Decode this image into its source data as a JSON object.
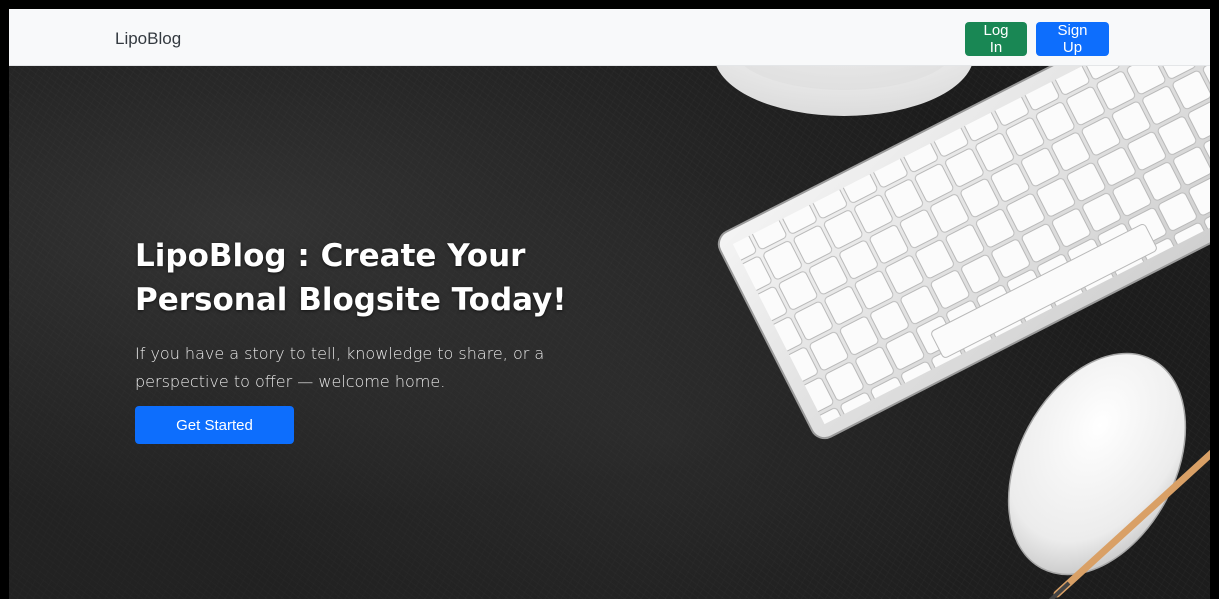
{
  "navbar": {
    "brand": "LipoBlog",
    "login_label": "Log In",
    "signup_label": "Sign Up"
  },
  "hero": {
    "title": "LipoBlog : Create Your Personal Blogsite Today!",
    "lead": "If you have a story to tell, knowledge to share, or a perspective to offer — welcome home.",
    "cta_label": "Get Started"
  },
  "colors": {
    "login_button": "#198754",
    "primary_button": "#0d6efd",
    "navbar_background": "#f8f9fa",
    "hero_background": "#1c1c1c"
  }
}
